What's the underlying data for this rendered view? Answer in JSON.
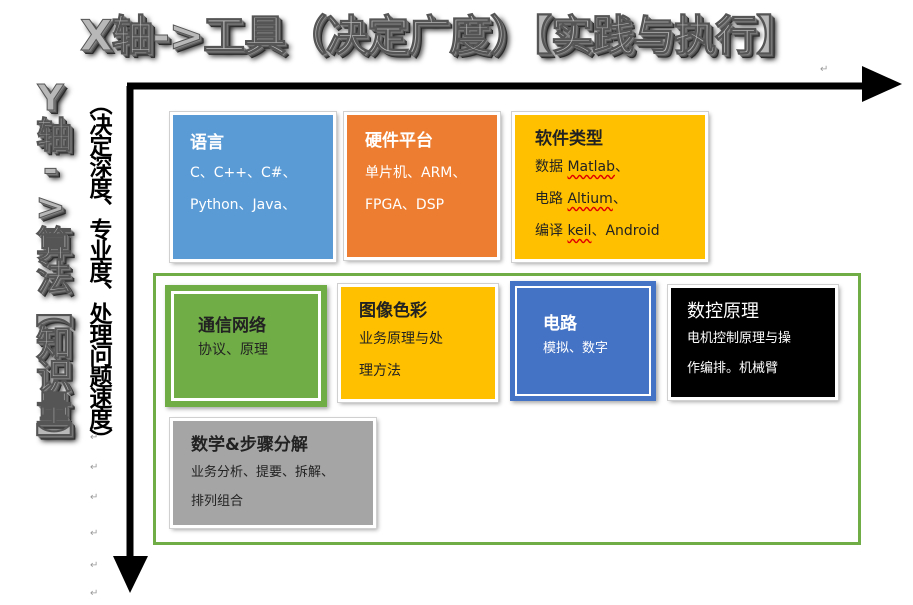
{
  "x_axis_title": "X轴->工具（决定广度）【实践与执行】",
  "y_axis_title": "Y轴->算法【知识量】",
  "y_axis_subtitle": "（决定深度、专业度、处理问题速度）",
  "para_mark": "↵",
  "colors": {
    "blue": "#5b9bd5",
    "orange": "#ed7d31",
    "gold": "#ffc000",
    "green": "#70ad47",
    "navy": "#4472c4",
    "gray": "#a5a5a5",
    "black": "#000000"
  },
  "boxes": {
    "language": {
      "title": "语言",
      "line1": "C、C++、C#、",
      "line2": "Python、Java、"
    },
    "hardware": {
      "title": "硬件平台",
      "line1": "单片机、ARM、",
      "line2": "FPGA、DSP"
    },
    "software": {
      "title": "软件类型",
      "l1_pre": "数据 ",
      "l1_word": "Matlab",
      "l1_post": "、",
      "l2_pre": "电路 ",
      "l2_word": "Altium",
      "l2_post": "、",
      "l3_pre": "编译 ",
      "l3_word": "keil",
      "l3_post": "、Android"
    },
    "comm": {
      "title": "通信网络",
      "line1": "协议、原理"
    },
    "image": {
      "title": "图像色彩",
      "line1": "业务原理与处",
      "line2": "理方法"
    },
    "circuit": {
      "title": "电路",
      "line1": "模拟、数字"
    },
    "cnc": {
      "title": "数控原理",
      "line1": "电机控制原理与操",
      "line2": "作编排。机械臂"
    },
    "math": {
      "title": "数学&步骤分解",
      "line1": "业务分析、提要、拆解、",
      "line2": "排列组合"
    }
  }
}
